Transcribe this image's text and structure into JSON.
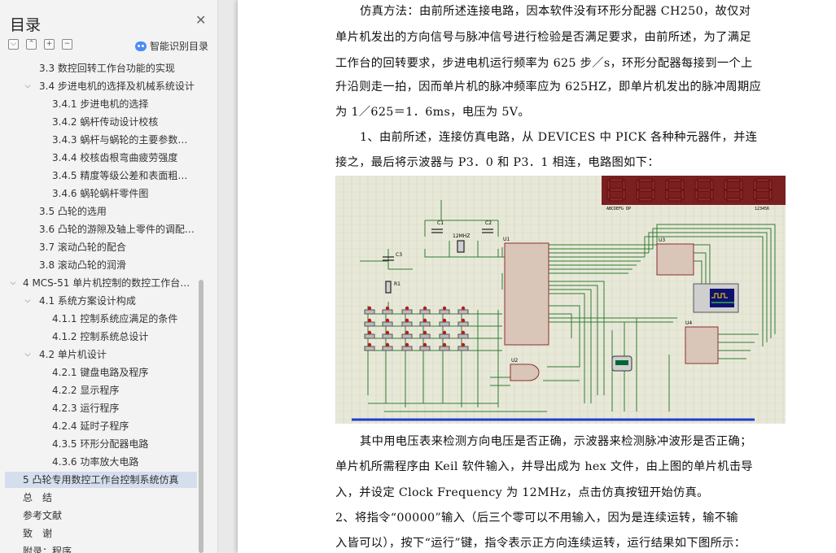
{
  "sidebar": {
    "title": "目录",
    "smart_label": "智能识别目录",
    "tools": [
      "⌵",
      "⌃",
      "+",
      "−"
    ],
    "items": [
      {
        "text": "3.3 数控回转工作台功能的实现",
        "level": 2,
        "arrow": ""
      },
      {
        "text": "3.4 步进电机的选择及机械系统设计",
        "level": 1,
        "arrow": "⌵"
      },
      {
        "text": "3.4.1 步进电机的选择",
        "level": 3,
        "arrow": ""
      },
      {
        "text": "3.4.2 蜗杆传动设计校核",
        "level": 3,
        "arrow": ""
      },
      {
        "text": "3.4.3 蜗杆与蜗轮的主要参数与几何尺寸",
        "level": 3,
        "arrow": ""
      },
      {
        "text": "3.4.4 校核齿根弯曲疲劳强度",
        "level": 3,
        "arrow": ""
      },
      {
        "text": "3.4.5 精度等级公差和表面粗糙度的确定",
        "level": 3,
        "arrow": ""
      },
      {
        "text": "3.4.6 蜗轮蜗杆零件图",
        "level": 3,
        "arrow": ""
      },
      {
        "text": "3.5 凸轮的选用",
        "level": 2,
        "arrow": ""
      },
      {
        "text": "3.6 凸轮的游隙及轴上零件的调配与固定",
        "level": 2,
        "arrow": ""
      },
      {
        "text": "3.7 滚动凸轮的配合",
        "level": 2,
        "arrow": ""
      },
      {
        "text": "3.8 滚动凸轮的润滑",
        "level": 2,
        "arrow": ""
      },
      {
        "text": "4 MCS-51 单片机控制的数控工作台系统设计",
        "level": 0,
        "arrow": "⌵"
      },
      {
        "text": "4.1 系统方案设计构成",
        "level": 1,
        "arrow": "⌵"
      },
      {
        "text": "4.1.1 控制系统应满足的条件",
        "level": 3,
        "arrow": ""
      },
      {
        "text": "4.1.2 控制系统总设计",
        "level": 3,
        "arrow": ""
      },
      {
        "text": "4.2 单片机设计",
        "level": 1,
        "arrow": "⌵"
      },
      {
        "text": "4.2.1 键盘电路及程序",
        "level": 3,
        "arrow": ""
      },
      {
        "text": "4.2.2 显示程序",
        "level": 3,
        "arrow": ""
      },
      {
        "text": "4.2.3 运行程序",
        "level": 3,
        "arrow": ""
      },
      {
        "text": "4.2.4 延时子程序",
        "level": 3,
        "arrow": ""
      },
      {
        "text": "4.3.5 环形分配器电路",
        "level": 3,
        "arrow": ""
      },
      {
        "text": "4.3.6 功率放大电路",
        "level": 3,
        "arrow": ""
      },
      {
        "text": "5 凸轮专用数控工作台控制系统仿真",
        "level": 0,
        "arrow": "",
        "selected": true
      },
      {
        "text": "总　结",
        "level": 0,
        "arrow": ""
      },
      {
        "text": "参考文献",
        "level": 0,
        "arrow": ""
      },
      {
        "text": "致　谢",
        "level": 0,
        "arrow": ""
      },
      {
        "text": "附录：程序",
        "level": 0,
        "arrow": ""
      }
    ]
  },
  "document": {
    "lines": [
      "仿真方法：由前所述连接电路，因本软件没有环形分配器 CH250，故仅对",
      "单片机发出的方向信号与脉冲信号进行检验是否满足要求，由前所述，为了满足",
      "工作台的回转要求，步进电机运行频率为 625 步／s，环形分配器每接到一个上",
      "升沿则走一拍，因而单片机的脉冲频率应为 625HZ，即单片机发出的脉冲周期应",
      "为 1／625＝1．6ms，电压为 5V。",
      "1、由前所述，连接仿真电路，从 DEVICES 中 PICK 各种种元器件，并连",
      "接之，最后将示波器与 P3．0 和 P3．1 相连，电路图如下："
    ],
    "lines_after": [
      "其中用电压表来检测方向电压是否正确，示波器来检测脉冲波形是否正确；",
      "单片机所需程序由 Keil 软件输入，并导出成为 hex 文件，由上图的单片机击导",
      "入，并设定 Clock Frequency 为 12MHz，点击仿真按钮开始仿真。",
      "2、将指令“00000”输入（后三个零可以不用输入，因为是连续运转，输不输",
      "入皆可以），按下“运行”键，指令表示正方向连续运转，运行结果如下图所示："
    ],
    "circuit_labels": {
      "u1": "U1",
      "u2": "U2",
      "u3": "U3",
      "u4": "U4",
      "c1": "C1",
      "c2": "C2",
      "c3": "C3",
      "r1": "R1",
      "crystal": "12MHZ",
      "display_left": "ABCDEFG  DP",
      "display_right": "123456"
    }
  }
}
